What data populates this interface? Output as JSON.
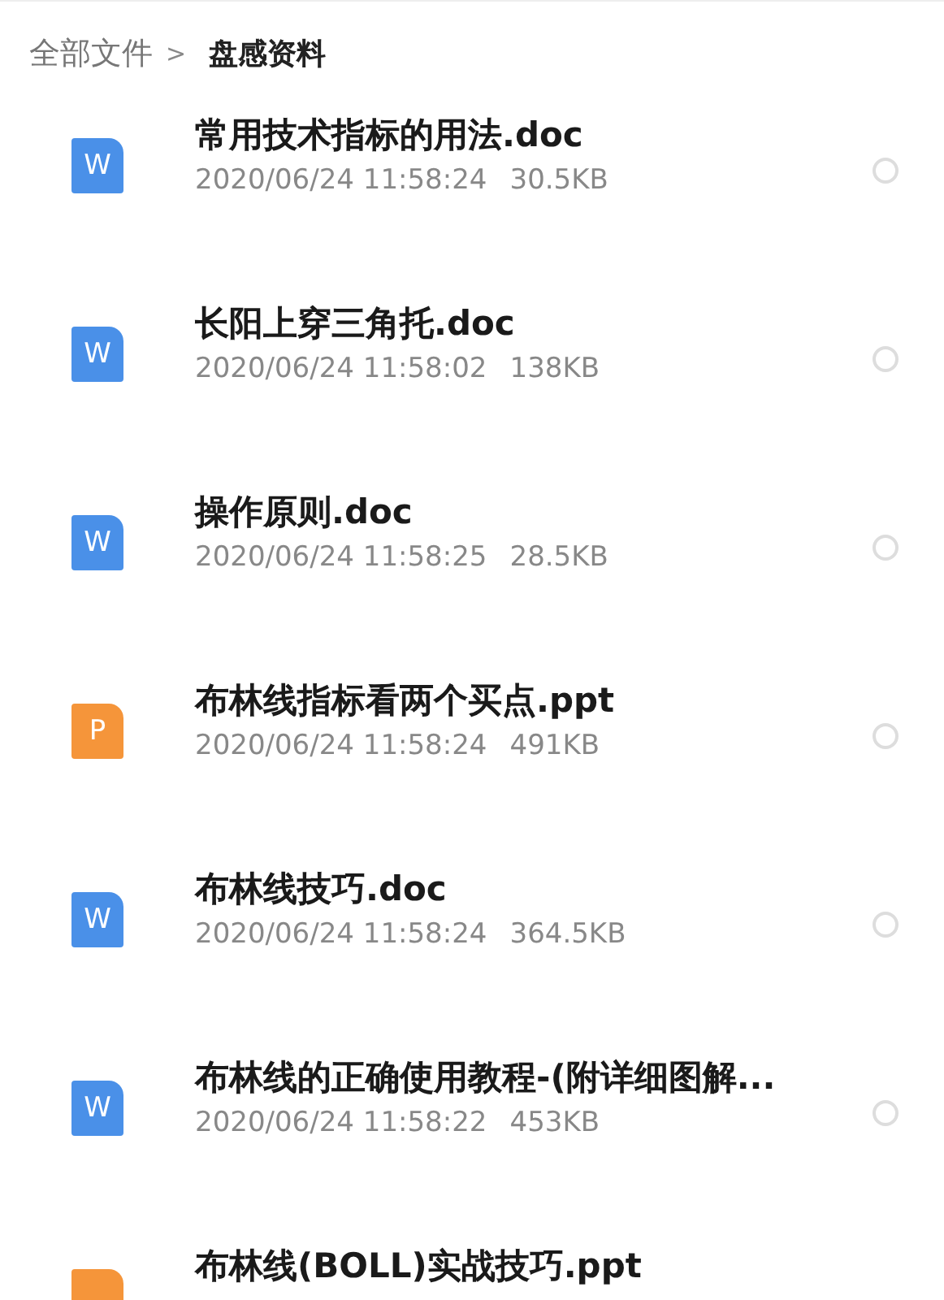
{
  "breadcrumb": {
    "root": "全部文件",
    "separator": ">",
    "current": "盘感资料"
  },
  "files": [
    {
      "kind": "doc",
      "icon_letter": "W",
      "name": "常用技术指标的用法.doc",
      "date": "2020/06/24 11:58:24",
      "size": "30.5KB",
      "selected": false
    },
    {
      "kind": "doc",
      "icon_letter": "W",
      "name": "长阳上穿三角托.doc",
      "date": "2020/06/24 11:58:02",
      "size": "138KB",
      "selected": false
    },
    {
      "kind": "doc",
      "icon_letter": "W",
      "name": "操作原则.doc",
      "date": "2020/06/24 11:58:25",
      "size": "28.5KB",
      "selected": false
    },
    {
      "kind": "ppt",
      "icon_letter": "P",
      "name": "布林线指标看两个买点.ppt",
      "date": "2020/06/24 11:58:24",
      "size": "491KB",
      "selected": false
    },
    {
      "kind": "doc",
      "icon_letter": "W",
      "name": "布林线技巧.doc",
      "date": "2020/06/24 11:58:24",
      "size": "364.5KB",
      "selected": false
    },
    {
      "kind": "doc",
      "icon_letter": "W",
      "name": "布林线的正确使用教程-(附详细图解...",
      "date": "2020/06/24 11:58:22",
      "size": "453KB",
      "selected": false
    },
    {
      "kind": "ppt",
      "name": "布林线(BOLL)实战技巧.ppt"
    }
  ]
}
